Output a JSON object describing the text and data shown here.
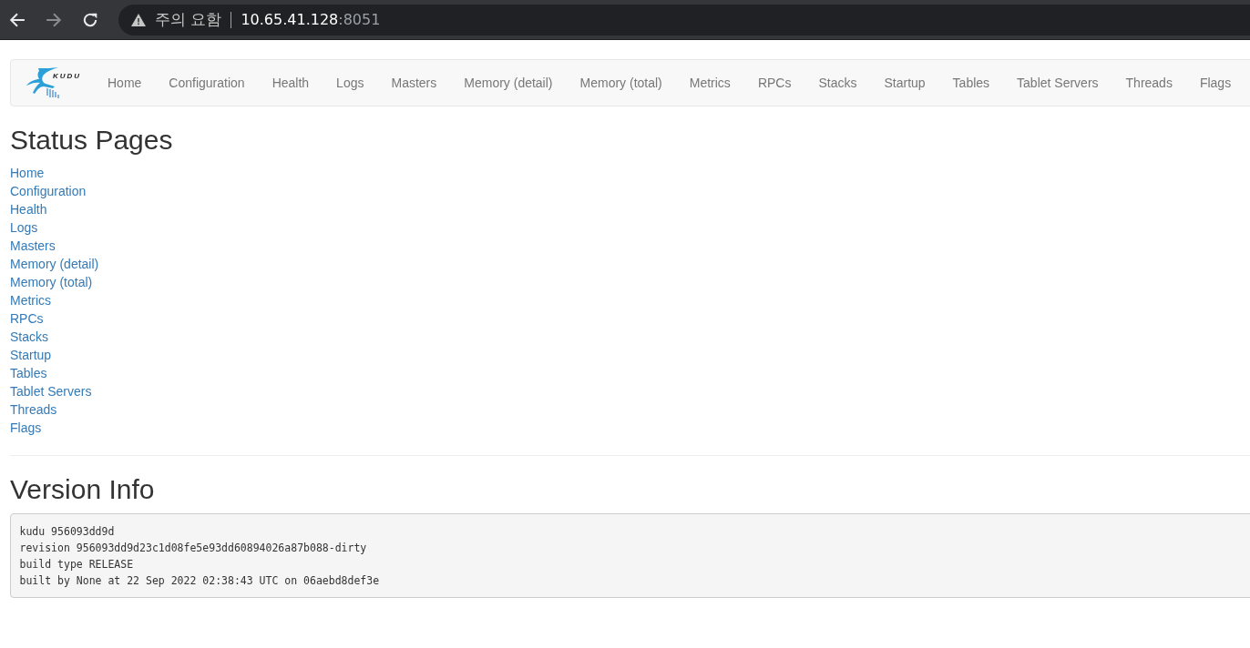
{
  "browser": {
    "security_label": "주의 요함",
    "url_host": "10.65.41.128",
    "url_port": ":8051",
    "forward_disabled": true
  },
  "navbar": {
    "logo_text": "KUDU",
    "items": [
      "Home",
      "Configuration",
      "Health",
      "Logs",
      "Masters",
      "Memory (detail)",
      "Memory (total)",
      "Metrics",
      "RPCs",
      "Stacks",
      "Startup",
      "Tables",
      "Tablet Servers",
      "Threads",
      "Flags"
    ]
  },
  "status_pages": {
    "title": "Status Pages",
    "links": [
      "Home",
      "Configuration",
      "Health",
      "Logs",
      "Masters",
      "Memory (detail)",
      "Memory (total)",
      "Metrics",
      "RPCs",
      "Stacks",
      "Startup",
      "Tables",
      "Tablet Servers",
      "Threads",
      "Flags"
    ]
  },
  "version_info": {
    "title": "Version Info",
    "lines": [
      "kudu 956093dd9d",
      "revision 956093dd9d23c1d08fe5e93dd60894026a87b088-dirty",
      "build type RELEASE",
      "built by None at 22 Sep 2022 02:38:43 UTC on 06aebd8def3e"
    ]
  }
}
